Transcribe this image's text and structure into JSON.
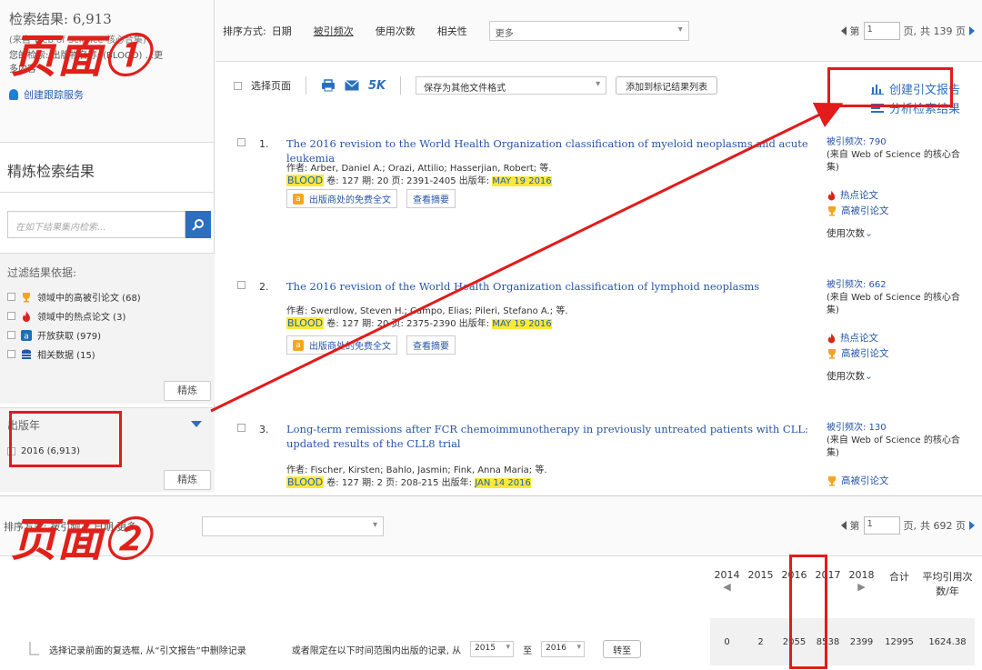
{
  "panel1": {
    "stamp": "页面①",
    "sidebar": {
      "hits_title": "检索结果: 6,913",
      "sub_line": "(来自 Web of Science 核心合集)",
      "scope_line": "您的检索: 出版物名称: (BLOOD) ...更",
      "more_link": "多内容",
      "alert_label": "创建跟踪服务",
      "refine_title": "精炼检索结果",
      "search_placeholder": "在如下结果集内检索...",
      "filter_title": "过滤结果依据:",
      "filters": [
        {
          "label": "领域中的高被引论文 (68)",
          "icon": "trophy-icon"
        },
        {
          "label": "领域中的热点论文 (3)",
          "icon": "fire-icon"
        },
        {
          "label": "开放获取 (979)",
          "icon": "open-access-icon"
        },
        {
          "label": "相关数据 (15)",
          "icon": "database-icon"
        }
      ],
      "refine_button": "精炼",
      "year_title": "出版年",
      "year_item": "2016 (6,913)",
      "refine_button2": "精炼"
    },
    "sort": {
      "label": "排序方式:",
      "options": [
        "日期",
        "被引频次",
        "使用次数",
        "相关性"
      ],
      "more": "更多"
    },
    "pager": {
      "prefix": "第",
      "page": "1",
      "mid": "页,",
      "total": "共 139 页"
    },
    "toolbar": {
      "select_page": "选择页面",
      "five_k": "5K",
      "save_format": "保存为其他文件格式",
      "add_marked": "添加到标记结果列表"
    },
    "report_links": {
      "citation_report": "创建引文报告",
      "analyze": "分析检索结果"
    },
    "records": [
      {
        "num": "1.",
        "title": "The 2016 revision to the World Health Organization classification of myeloid neoplasms and acute leukemia",
        "authors": "作者: Arber, Daniel A.; Orazi, Attilio; Hasserjian, Robert; 等.",
        "journal": "BLOOD",
        "src": "卷: 127  期: 20  页: 2391-2405  出版年:",
        "date": "MAY 19 2016",
        "oa_label": "出版商处的免费全文",
        "abstract_label": "查看摘要",
        "cited": "被引频次: 790",
        "cited_src": "(来自 Web of Science 的核心合集)",
        "hot": "热点论文",
        "highly": "高被引论文",
        "usage": "使用次数"
      },
      {
        "num": "2.",
        "title": "The 2016 revision of the World Health Organization classification of lymphoid neoplasms",
        "authors": "作者: Swerdlow, Steven H.; Campo, Elias; Pileri, Stefano A.; 等.",
        "journal": "BLOOD",
        "src": "卷: 127  期: 20  页: 2375-2390  出版年:",
        "date": "MAY 19 2016",
        "oa_label": "出版商处的免费全文",
        "abstract_label": "查看摘要",
        "cited": "被引频次: 662",
        "cited_src": "(来自 Web of Science 的核心合集)",
        "hot": "热点论文",
        "highly": "高被引论文",
        "usage": "使用次数"
      },
      {
        "num": "3.",
        "title": "Long-term remissions after FCR chemoimmunotherapy in previously untreated patients with CLL: updated results of the CLL8 trial",
        "authors": "作者: Fischer, Kirsten; Bahlo, Jasmin; Fink, Anna Maria; 等.",
        "journal": "BLOOD",
        "src": "卷: 127  期: 2  页: 208-215  出版年:",
        "date": "JAN 14 2016",
        "cited": "被引频次: 130",
        "cited_src": "(来自 Web of Science 的核心合集)",
        "highly": "高被引论文"
      }
    ]
  },
  "panel2": {
    "stamp": "页面②",
    "sort_label": "排序方式: 被引频次 日期 更多",
    "pager": {
      "prefix": "第",
      "page": "1",
      "mid": "页,",
      "total": "共 692 页"
    },
    "years": [
      "2014",
      "2015",
      "2016",
      "2017",
      "2018"
    ],
    "total_label": "合计",
    "avg_label": "平均引用次数/年",
    "values": [
      "0",
      "2",
      "2055",
      "8538",
      "2399",
      "12995",
      "1624.38"
    ],
    "delete_hint": "选择记录前面的复选框, 从“引文报告”中删除记录",
    "range_hint": "或者限定在以下时间范围内出版的记录, 从",
    "from_year": "2015",
    "to_label": "至",
    "to_year": "2016",
    "go_label": "转至"
  },
  "colors": {
    "accent": "#2b6fbe",
    "red": "#e21b1b",
    "highlight": "#ffe837"
  }
}
